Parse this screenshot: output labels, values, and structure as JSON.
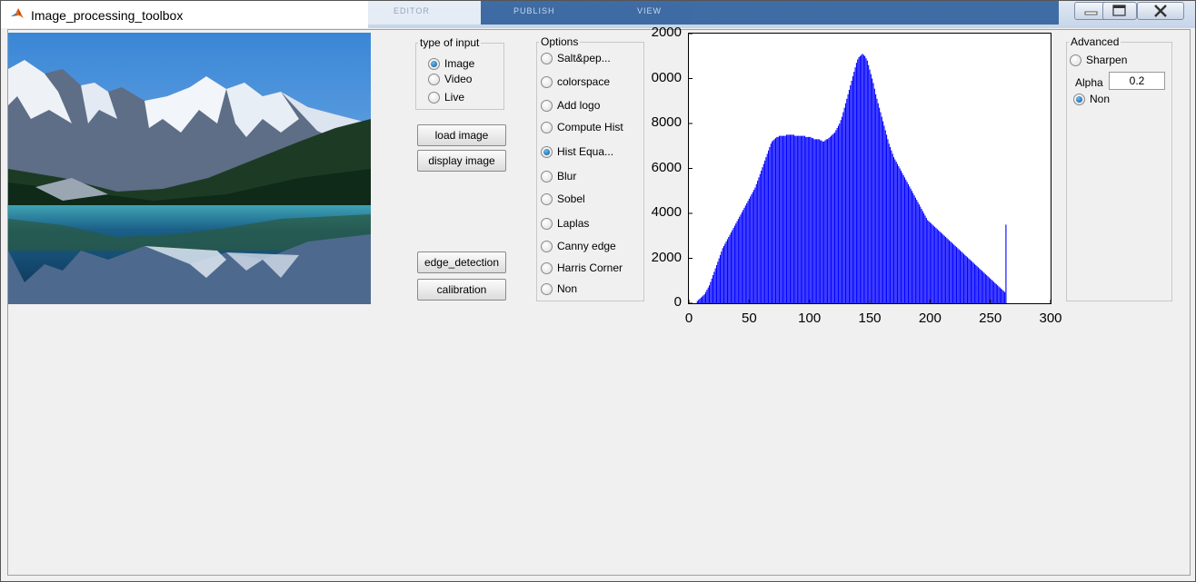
{
  "window": {
    "title": "Image_processing_toolbox",
    "background_tabs": [
      "EDITOR",
      "PUBLISH",
      "VIEW"
    ]
  },
  "input_panel": {
    "legend": "type of input",
    "options": [
      {
        "label": "Image",
        "selected": true
      },
      {
        "label": "Video",
        "selected": false
      },
      {
        "label": "Live",
        "selected": false
      }
    ]
  },
  "buttons": {
    "load": "load image",
    "display": "display image",
    "edge": "edge_detection",
    "calibration": "calibration"
  },
  "options_panel": {
    "legend": "Options",
    "items": [
      {
        "label": "Salt&pep...",
        "selected": false
      },
      {
        "label": "colorspace",
        "selected": false
      },
      {
        "label": "Add logo",
        "selected": false
      },
      {
        "label": "Compute Hist",
        "selected": false
      },
      {
        "label": "Hist Equa...",
        "selected": true
      },
      {
        "label": "Blur",
        "selected": false
      },
      {
        "label": "Sobel",
        "selected": false
      },
      {
        "label": "Laplas",
        "selected": false
      },
      {
        "label": "Canny edge",
        "selected": false
      },
      {
        "label": "Harris Corner",
        "selected": false
      },
      {
        "label": "Non",
        "selected": false
      }
    ]
  },
  "advanced_panel": {
    "legend": "Advanced",
    "sharpen": {
      "label": "Sharpen",
      "selected": false
    },
    "alpha_label": "Alpha",
    "alpha_value": "0.2",
    "non": {
      "label": "Non",
      "selected": true
    }
  },
  "chart_data": {
    "type": "bar",
    "title": "",
    "xlabel": "",
    "ylabel": "",
    "xlim": [
      0,
      300
    ],
    "ylim": [
      0,
      12000
    ],
    "xticks": [
      "0",
      "50",
      "100",
      "150",
      "200",
      "250",
      "300"
    ],
    "yticks": [
      "0",
      "2000",
      "4000",
      "6000",
      "8000",
      "0000",
      "2000"
    ],
    "bar_color": "#0000ff",
    "grid": false,
    "values": [
      0,
      0,
      0,
      0,
      0,
      0,
      100,
      150,
      200,
      250,
      300,
      350,
      400,
      500,
      600,
      700,
      800,
      950,
      1100,
      1250,
      1400,
      1550,
      1700,
      1850,
      2000,
      2150,
      2300,
      2450,
      2550,
      2650,
      2750,
      2850,
      2950,
      3050,
      3150,
      3250,
      3350,
      3450,
      3550,
      3650,
      3750,
      3850,
      3950,
      4050,
      4150,
      4250,
      4350,
      4450,
      4550,
      4650,
      4750,
      4850,
      4950,
      5050,
      5150,
      5300,
      5450,
      5600,
      5750,
      5900,
      6050,
      6200,
      6350,
      6500,
      6650,
      6800,
      6950,
      7100,
      7200,
      7250,
      7300,
      7350,
      7400,
      7400,
      7450,
      7450,
      7450,
      7450,
      7450,
      7450,
      7500,
      7500,
      7500,
      7500,
      7500,
      7500,
      7500,
      7450,
      7450,
      7450,
      7450,
      7450,
      7450,
      7450,
      7450,
      7450,
      7400,
      7400,
      7400,
      7400,
      7400,
      7350,
      7350,
      7300,
      7300,
      7300,
      7300,
      7300,
      7250,
      7250,
      7200,
      7200,
      7250,
      7300,
      7300,
      7350,
      7400,
      7450,
      7500,
      7550,
      7600,
      7700,
      7800,
      7900,
      8000,
      8150,
      8300,
      8500,
      8700,
      8900,
      9100,
      9300,
      9500,
      9700,
      9900,
      10100,
      10300,
      10500,
      10700,
      10850,
      10950,
      11000,
      11050,
      11100,
      11050,
      11000,
      10900,
      10800,
      10600,
      10400,
      10200,
      10000,
      9800,
      9550,
      9300,
      9100,
      8900,
      8700,
      8500,
      8300,
      8100,
      7900,
      7700,
      7500,
      7300,
      7100,
      6950,
      6800,
      6650,
      6500,
      6400,
      6300,
      6200,
      6100,
      6000,
      5900,
      5800,
      5700,
      5600,
      5500,
      5400,
      5300,
      5200,
      5100,
      5000,
      4900,
      4800,
      4700,
      4600,
      4500,
      4400,
      4300,
      4200,
      4100,
      4000,
      3900,
      3800,
      3700,
      3650,
      3600,
      3550,
      3500,
      3450,
      3400,
      3350,
      3300,
      3250,
      3200,
      3150,
      3100,
      3050,
      3000,
      2950,
      2900,
      2850,
      2800,
      2750,
      2700,
      2650,
      2600,
      2550,
      2500,
      2450,
      2400,
      2350,
      2300,
      2250,
      2200,
      2150,
      2100,
      2050,
      2000,
      1950,
      1900,
      1850,
      1800,
      1750,
      1700,
      1650,
      1600,
      1550,
      1500,
      1450,
      1400,
      1350,
      1300,
      1250,
      1200,
      1150,
      1100,
      1050,
      1000,
      950,
      900,
      850,
      800,
      750,
      700,
      650,
      600,
      550,
      500,
      3500
    ]
  }
}
